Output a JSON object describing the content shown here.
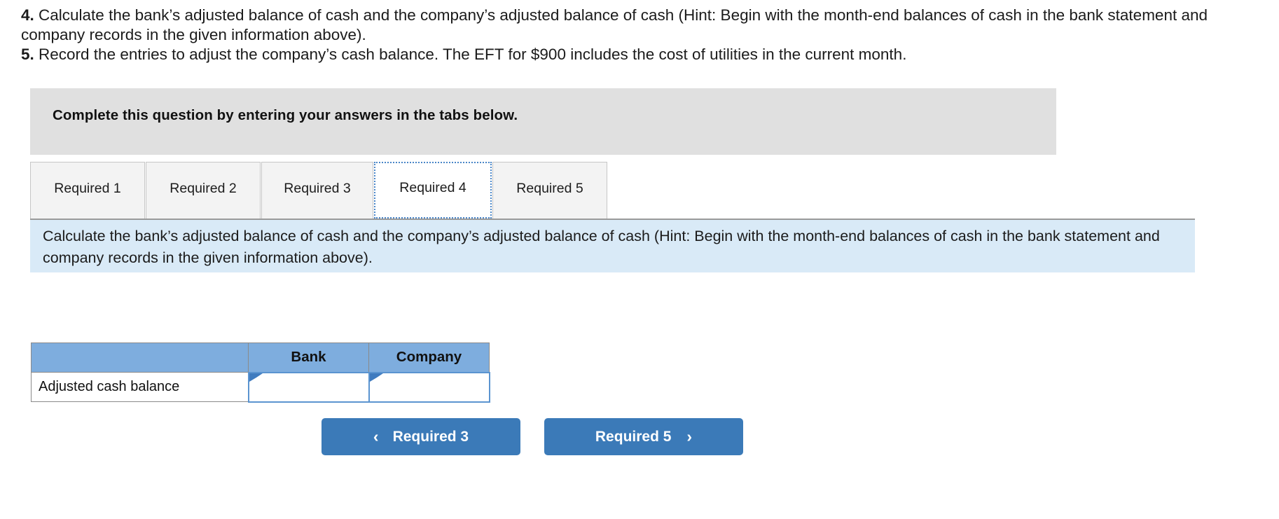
{
  "prompt": {
    "q4_number": "4.",
    "q4_text": " Calculate the bank’s adjusted balance of cash and the company’s adjusted balance of cash (Hint: Begin with the month-end balances of cash in the bank statement and company records in the given information above).",
    "q5_number": "5.",
    "q5_text": " Record the entries to adjust the company’s cash balance. The EFT for $900 includes the cost of utilities in the current month."
  },
  "banner": {
    "text": "Complete this question by entering your answers in the tabs below."
  },
  "tabs": {
    "items": [
      {
        "label": "Required 1",
        "active": false
      },
      {
        "label": "Required 2",
        "active": false
      },
      {
        "label": "Required 3",
        "active": false
      },
      {
        "label": "Required 4",
        "active": true
      },
      {
        "label": "Required 5",
        "active": false
      }
    ]
  },
  "description": {
    "text": "Calculate the bank’s adjusted balance of cash and the company’s adjusted balance of cash (Hint: Begin with the month-end balances of cash in the bank statement and company records in the given information above)."
  },
  "table": {
    "headers": [
      "",
      "Bank",
      "Company"
    ],
    "rows": [
      {
        "label": "Adjusted cash balance",
        "bank_value": "",
        "company_value": ""
      }
    ]
  },
  "navigation": {
    "prev_label": "Required 3",
    "next_label": "Required 5",
    "prev_icon": "chevron-left-icon",
    "next_icon": "chevron-right-icon",
    "chev_left": "‹",
    "chev_right": "›"
  },
  "colors": {
    "banner_gray": "#e0e0e0",
    "panel_blue": "#d9eaf7",
    "table_header_blue": "#7eadde",
    "button_blue": "#3b7ab8",
    "focus_blue": "#4a86c8"
  }
}
